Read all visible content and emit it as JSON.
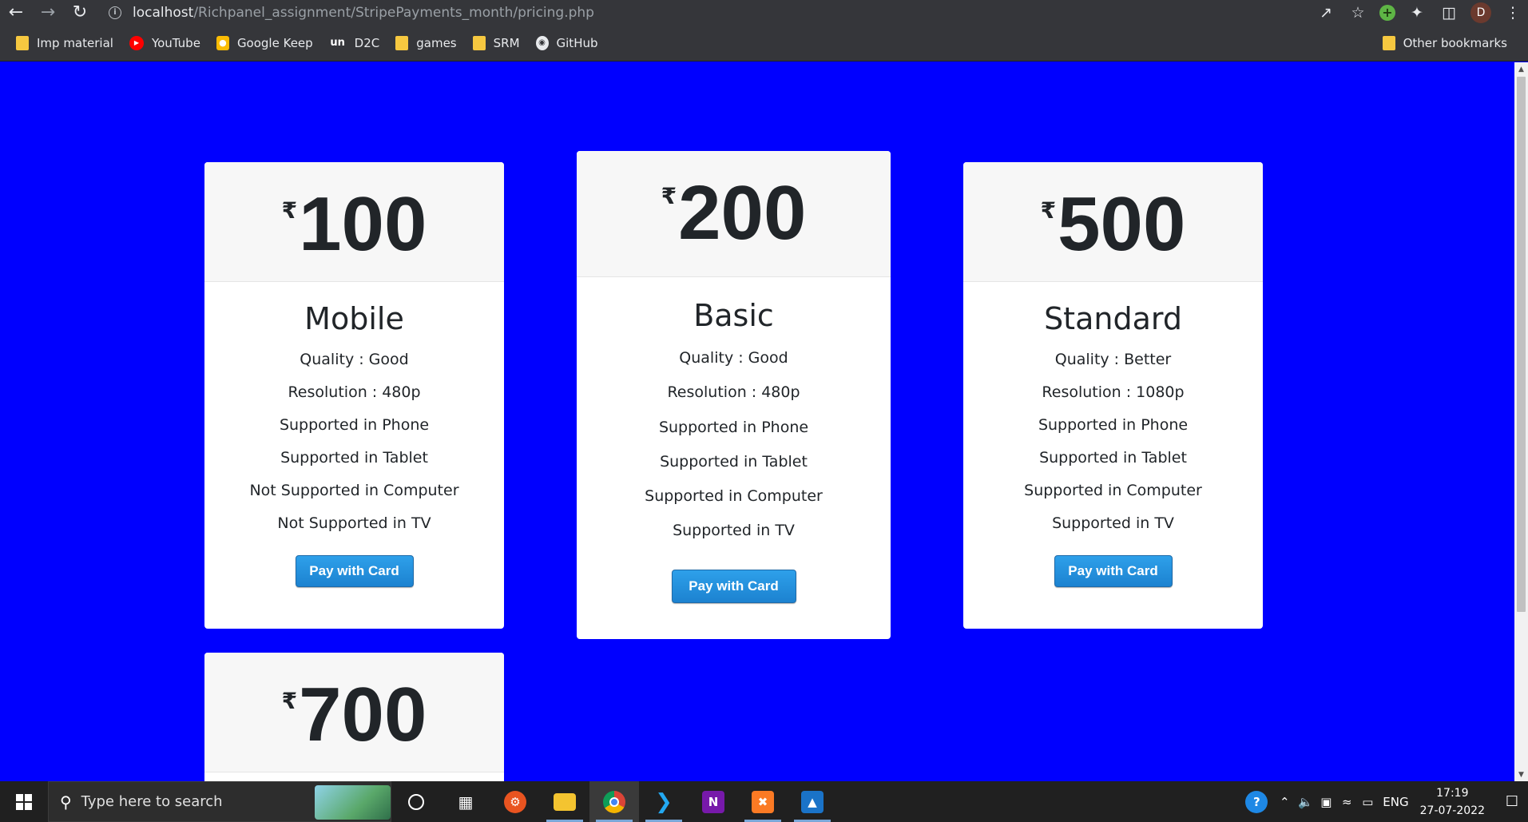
{
  "browser": {
    "url_host": "localhost",
    "url_path": "/Richpanel_assignment/StripePayments_month/pricing.php",
    "profile_initial": "D"
  },
  "bookmarks": [
    {
      "label": "Imp material",
      "icon": "folder-icon"
    },
    {
      "label": "YouTube",
      "icon": "youtube-icon"
    },
    {
      "label": "Google Keep",
      "icon": "google-keep-icon"
    },
    {
      "label": "D2C",
      "icon": "unacademy-icon",
      "icon_text": "un"
    },
    {
      "label": "games",
      "icon": "folder-icon"
    },
    {
      "label": "SRM",
      "icon": "folder-icon"
    },
    {
      "label": "GitHub",
      "icon": "github-icon"
    }
  ],
  "other_bookmarks": "Other bookmarks",
  "currency_symbol": "₹",
  "plans": [
    {
      "price": "100",
      "name": "Mobile",
      "features": [
        "Quality : Good",
        "Resolution : 480p",
        "Supported in Phone",
        "Supported in Tablet",
        "Not Supported in Computer",
        "Not Supported in TV"
      ],
      "button": "Pay with Card"
    },
    {
      "price": "200",
      "name": "Basic",
      "features": [
        "Quality : Good",
        "Resolution : 480p",
        "Supported in Phone",
        "Supported in Tablet",
        "Supported in Computer",
        "Supported in TV"
      ],
      "button": "Pay with Card"
    },
    {
      "price": "500",
      "name": "Standard",
      "features": [
        "Quality : Better",
        "Resolution : 1080p",
        "Supported in Phone",
        "Supported in Tablet",
        "Supported in Computer",
        "Supported in TV"
      ],
      "button": "Pay with Card"
    },
    {
      "price": "700"
    }
  ],
  "taskbar": {
    "search_placeholder": "Type here to search",
    "language": "ENG",
    "time": "17:19",
    "date": "27-07-2022"
  },
  "colors": {
    "page_background": "#0000ff",
    "button_blue": "#1c82d0",
    "card_header": "#f7f7f7"
  }
}
